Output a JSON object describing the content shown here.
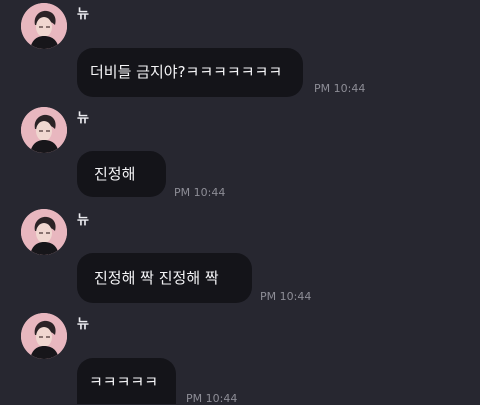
{
  "messages": [
    {
      "sender": "뉴",
      "text": "더비들 금지야?ㅋㅋㅋㅋㅋㅋㅋ",
      "time": "PM 10:44"
    },
    {
      "sender": "뉴",
      "text": "진정해",
      "time": "PM 10:44"
    },
    {
      "sender": "뉴",
      "text": "진정해 짝 진정해 짝",
      "time": "PM 10:44"
    },
    {
      "sender": "뉴",
      "text": "ㅋㅋㅋㅋㅋ",
      "time": "PM 10:44"
    }
  ],
  "colors": {
    "background": "#272730",
    "bubble": "#141419",
    "text": "#f4f4f6",
    "time": "#8d8d96",
    "avatar": "#e8b7bf"
  },
  "icons": {
    "avatar": "profile-avatar"
  }
}
